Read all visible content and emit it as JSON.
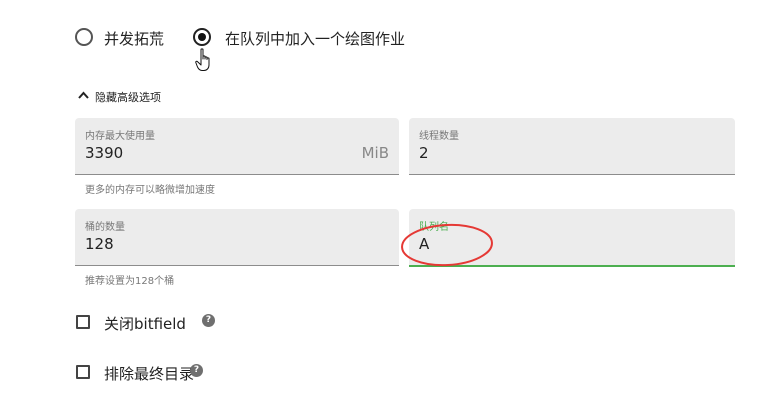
{
  "options": {
    "radio_parallel": "并发拓荒",
    "radio_queue": "在队列中加入一个绘图作业"
  },
  "advanced": {
    "toggle_label": "隐藏高级选项",
    "memory": {
      "label": "内存最大使用量",
      "value": "3390",
      "unit": "MiB",
      "hint": "更多的内存可以略微增加速度"
    },
    "threads": {
      "label": "线程数量",
      "value": "2"
    },
    "buckets": {
      "label": "桶的数量",
      "value": "128",
      "hint": "推荐设置为128个桶"
    },
    "queue_name": {
      "label": "队列名",
      "value": "A"
    }
  },
  "checkboxes": {
    "disable_bitfield": "关闭bitfield",
    "exclude_final_dir": "排除最终目录"
  },
  "icons": {
    "help": "help-circle-icon",
    "caret": "chevron-up-icon",
    "cursor": "hand-pointer-icon"
  },
  "colors": {
    "accent": "#4caf50",
    "annotation": "#e53935",
    "field_bg": "#ececec"
  }
}
